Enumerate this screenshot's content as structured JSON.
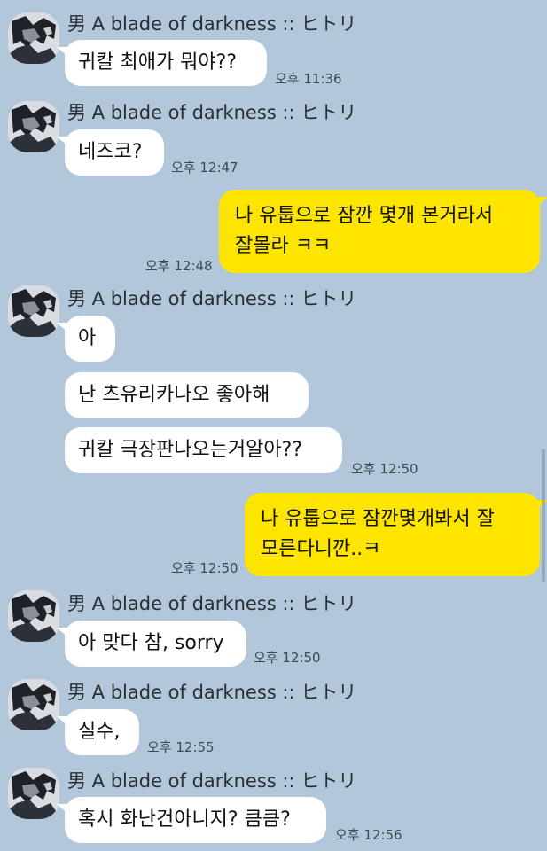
{
  "colors": {
    "background": "#b2c7d9",
    "incoming_bubble": "#ffffff",
    "outgoing_bubble": "#fee500"
  },
  "sender_name": "男 A blade of darkness :: ヒトリ",
  "messages": [
    {
      "direction": "in",
      "text": "귀칼 최애가 뭐야??",
      "time": "오후 11:36"
    },
    {
      "direction": "in",
      "text": "네즈코?",
      "time": "오후 12:47"
    },
    {
      "direction": "out",
      "lines": [
        "나 유툽으로 잠깐 몇개 본거라서",
        "잘몰라 ㅋㅋ"
      ],
      "time": "오후 12:48"
    },
    {
      "direction": "in",
      "text": "아"
    },
    {
      "direction": "in",
      "text": "난 츠유리카나오 좋아해"
    },
    {
      "direction": "in",
      "text": "귀칼 극장판나오는거알아??",
      "time": "오후 12:50"
    },
    {
      "direction": "out",
      "lines": [
        "나 유툽으로 잠깐몇개봐서 잘",
        "모른다니깐..ㅋ"
      ],
      "time": "오후 12:50"
    },
    {
      "direction": "in",
      "text": "아 맞다 참, sorry",
      "time": "오후 12:50"
    },
    {
      "direction": "in",
      "text": "실수,",
      "time": "오후 12:55"
    },
    {
      "direction": "in",
      "text": "혹시 화난건아니지? 큼큼?",
      "time": "오후 12:56"
    }
  ]
}
